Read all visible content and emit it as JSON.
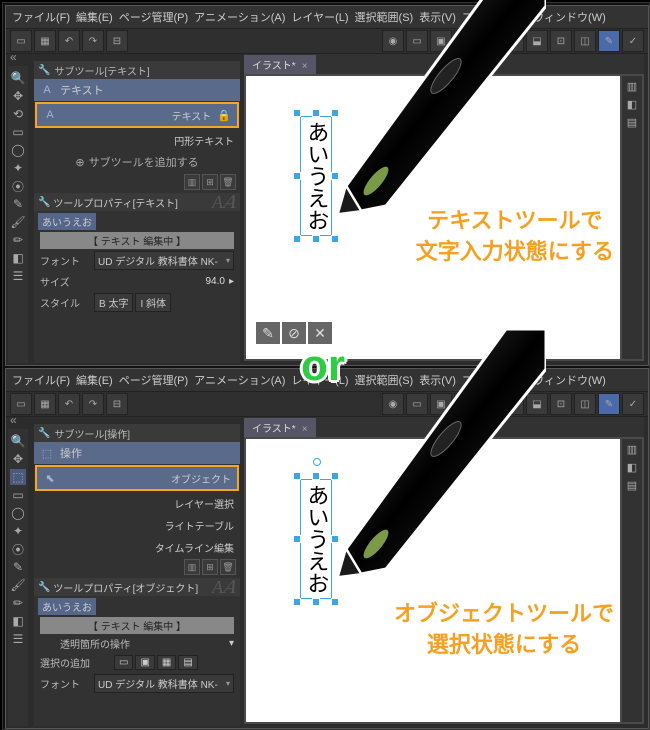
{
  "menus": [
    "ファイル(F)",
    "編集(E)",
    "ページ管理(P)",
    "アニメーション(A)",
    "レイヤー(L)",
    "選択範囲(S)",
    "表示(V)",
    "フィルター(I)",
    "ウィンドウ(W)"
  ],
  "top": {
    "subtool_header": "サブツール[テキスト]",
    "group_label": "テキスト",
    "item_sel": "テキスト",
    "item2": "円形テキスト",
    "add_label": "サブツールを追加する",
    "prop_header": "ツールプロパティ[テキスト]",
    "tag": "あいうえお",
    "section": "【 テキスト 編集中 】",
    "font_label": "フォント",
    "font_value": "UD デジタル 教科書体 NK-",
    "size_label": "サイズ",
    "size_value": "94.0",
    "style_label": "スタイル",
    "btn_bold": "B 太字",
    "btn_italic": "I 斜体",
    "canvas_text": "あいうえお",
    "tab_label": "イラスト*",
    "annotation_l1": "テキストツールで",
    "annotation_l2": "文字入力状態にする"
  },
  "bot": {
    "subtool_header": "サブツール[操作]",
    "group_label": "操作",
    "item_sel": "オブジェクト",
    "item2": "レイヤー選択",
    "item3": "ライトテーブル",
    "item4": "タイムライン編集",
    "prop_header": "ツールプロパティ[オブジェクト]",
    "tag": "あいうえお",
    "section": "【 テキスト 編集中 】",
    "section2": "透明箇所の操作",
    "select_label": "選択の追加",
    "font_label": "フォント",
    "font_value": "UD デジタル 教科書体 NK-",
    "canvas_text": "あいうえお",
    "tab_label": "イラスト*",
    "annotation_l1": "オブジェクトツールで",
    "annotation_l2": "選択状態にする"
  },
  "or_text": "or",
  "icons": {
    "lock": "🔒",
    "plus": "⊕",
    "pencil": "✎",
    "check": "✔",
    "close": "✕",
    "magnify": "🔍",
    "hand": "✋",
    "text": "A",
    "rect": "▭",
    "lasso": "◯"
  }
}
